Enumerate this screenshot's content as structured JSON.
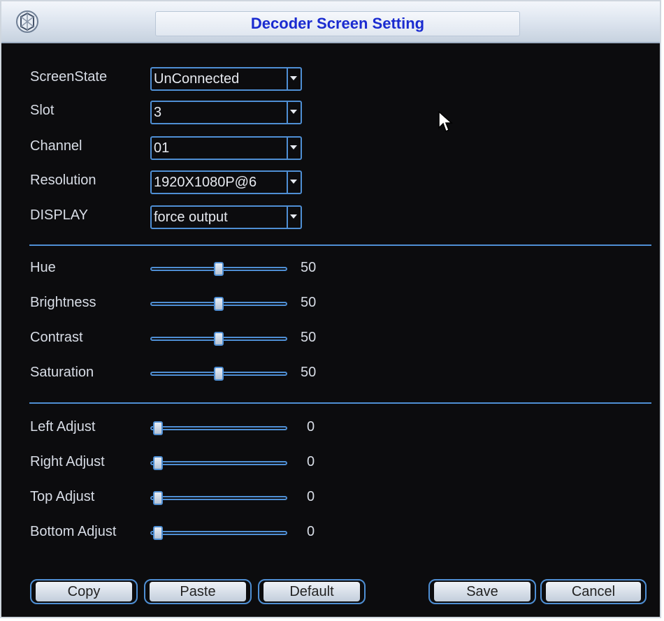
{
  "window": {
    "title": "Decoder Screen Setting"
  },
  "fields": {
    "screen_state": {
      "label": "ScreenState",
      "value": "UnConnected"
    },
    "slot": {
      "label": "Slot",
      "value": "3"
    },
    "channel": {
      "label": "Channel",
      "value": "01"
    },
    "resolution": {
      "label": "Resolution",
      "value": "1920X1080P@6"
    },
    "display": {
      "label": "DISPLAY",
      "value": "force output"
    }
  },
  "color_sliders": [
    {
      "label": "Hue",
      "value": "50",
      "fraction": 0.5
    },
    {
      "label": "Brightness",
      "value": "50",
      "fraction": 0.5
    },
    {
      "label": "Contrast",
      "value": "50",
      "fraction": 0.5
    },
    {
      "label": "Saturation",
      "value": "50",
      "fraction": 0.5
    }
  ],
  "adjust_sliders": [
    {
      "label": "Left Adjust",
      "value": "0",
      "fraction": 0
    },
    {
      "label": "Right Adjust",
      "value": "0",
      "fraction": 0
    },
    {
      "label": "Top Adjust",
      "value": "0",
      "fraction": 0
    },
    {
      "label": "Bottom Adjust",
      "value": "0",
      "fraction": 0
    }
  ],
  "buttons": {
    "copy": "Copy",
    "paste": "Paste",
    "default": "Default",
    "save": "Save",
    "cancel": "Cancel"
  },
  "colors": {
    "accent": "#4f8fd4",
    "title_text": "#1a2bd0",
    "background": "#0c0c0e"
  },
  "icons": {
    "app": "decoder-app-icon",
    "dropdown": "chevron-down-icon",
    "pointer": "mouse-pointer-icon"
  }
}
